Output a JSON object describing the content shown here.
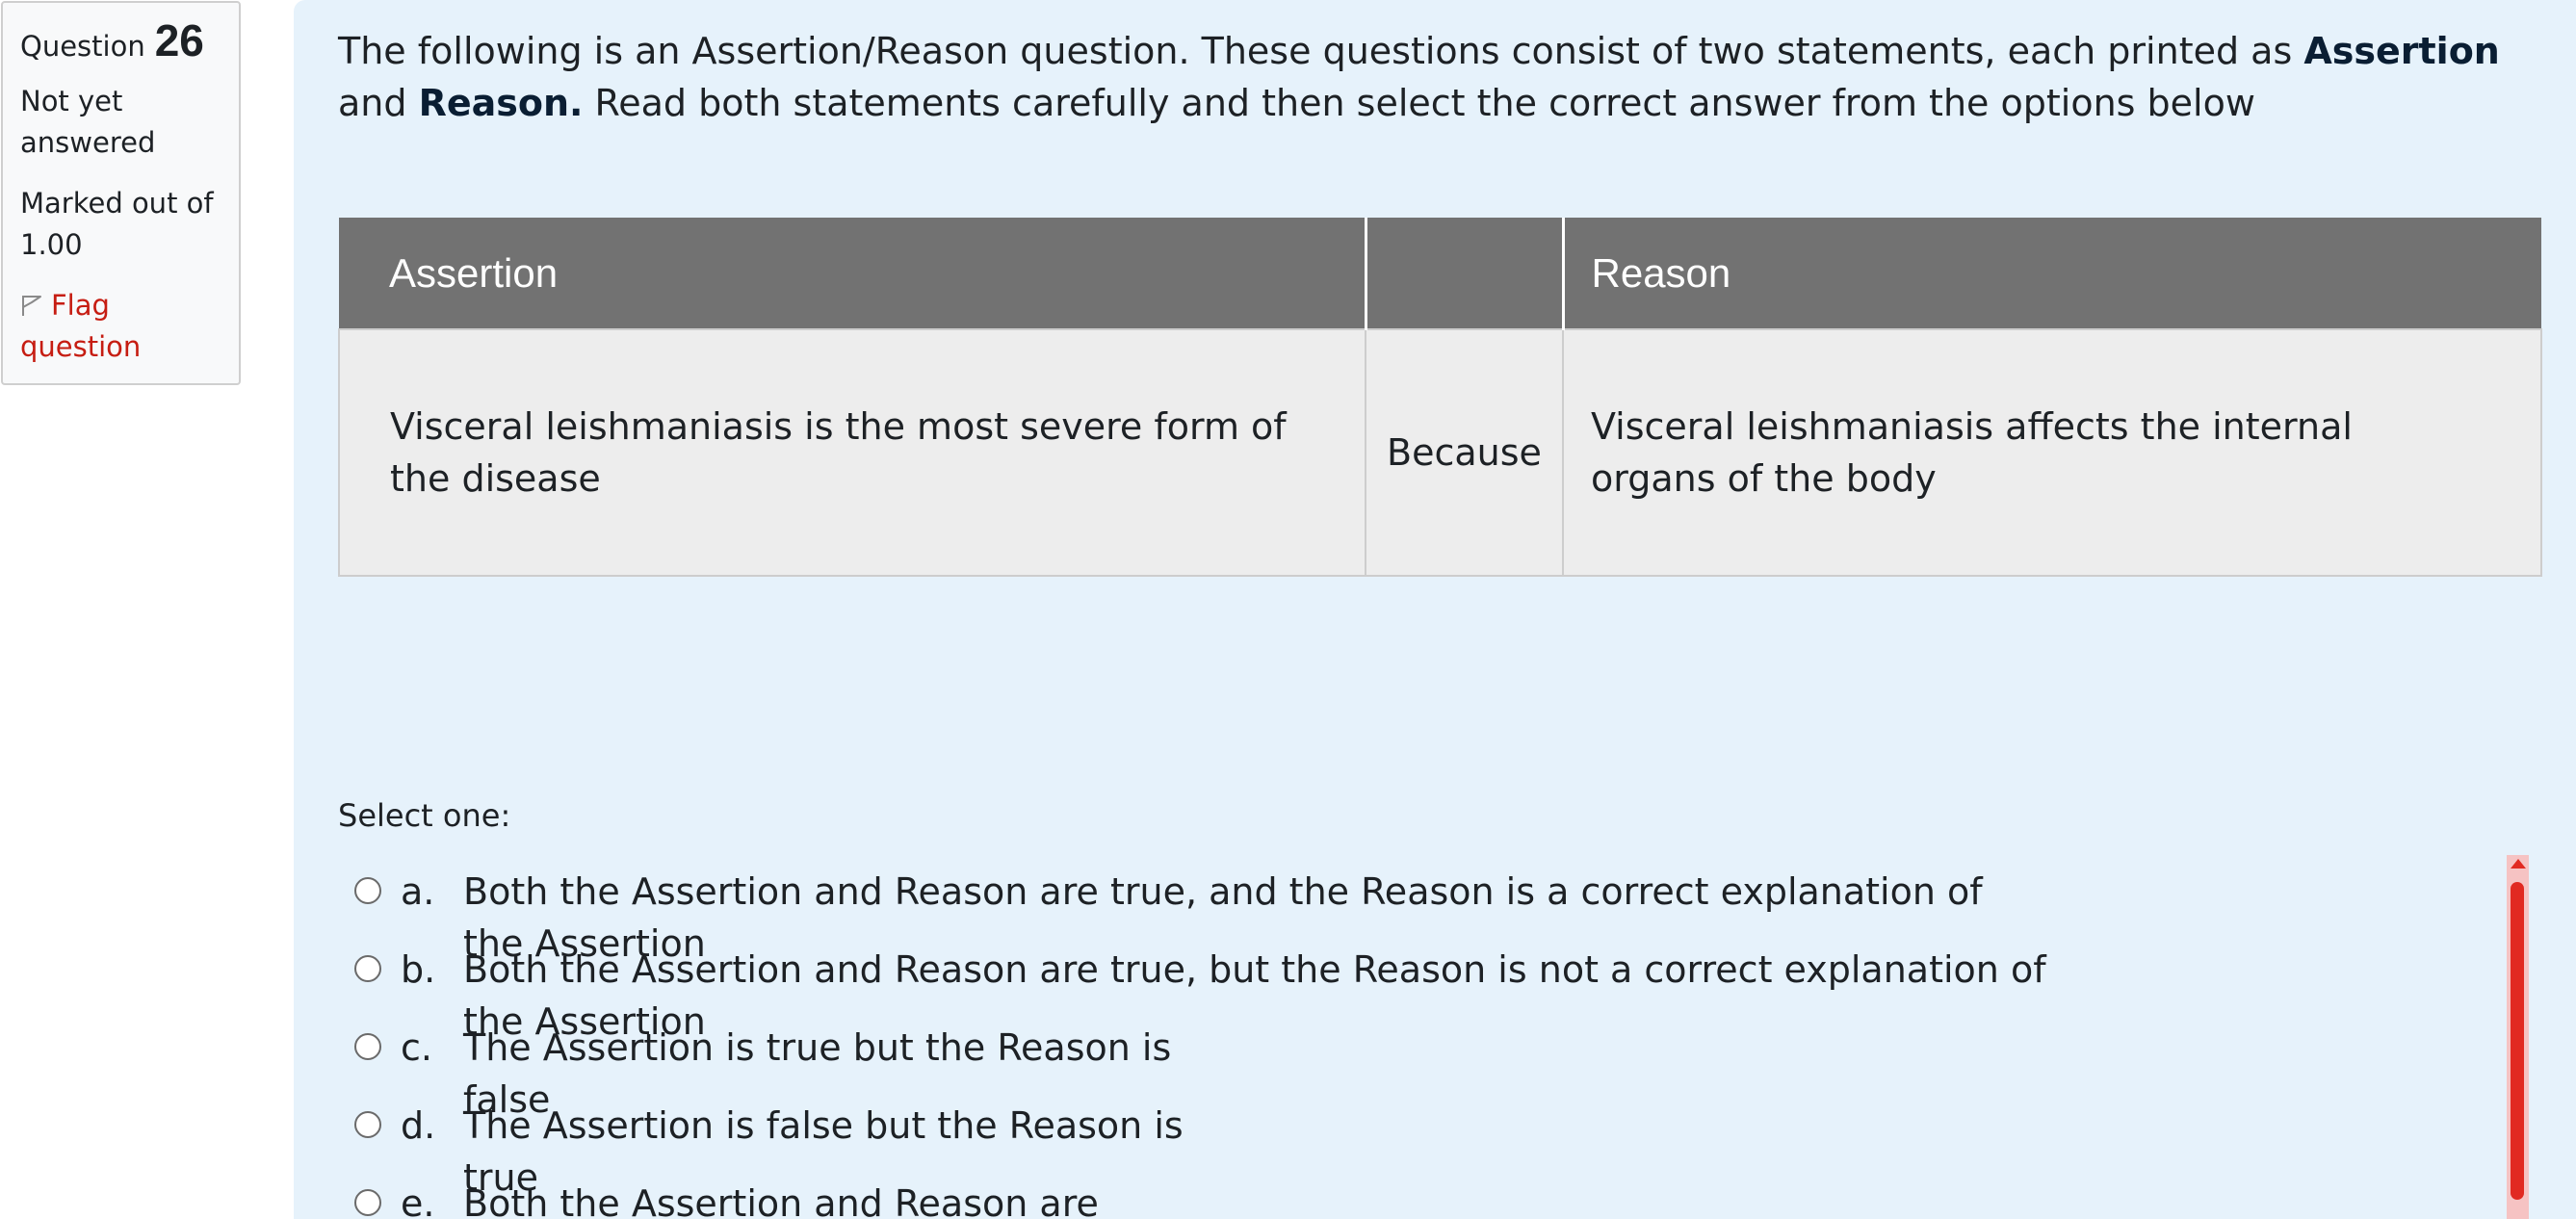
{
  "info": {
    "question_label": "Question",
    "question_number": "26",
    "state": "Not yet answered",
    "grade": "Marked out of 1.00",
    "flag_label": "Flag question"
  },
  "question": {
    "intro_part1": "The following is an Assertion/Reason question.  These questions consist of two statements, each printed as ",
    "intro_bold1": "Assertion",
    "intro_and": " and ",
    "intro_bold2": "Reason.",
    "intro_part2": " Read both statements carefully and then select the correct answer from the options below",
    "table": {
      "header_assertion": "Assertion",
      "header_middle": "",
      "header_reason": "Reason",
      "assertion": "Visceral leishmaniasis is the most severe form of the disease",
      "connector": "Because",
      "reason": "Visceral leishmaniasis affects the internal organs of the body"
    },
    "select_prompt": "Select one:",
    "options": [
      {
        "letter": "a.",
        "text": "Both the Assertion and Reason are true, and the Reason is a correct explanation of the Assertion"
      },
      {
        "letter": "b.",
        "text": "Both the Assertion and Reason are true, but the Reason is not a correct explanation of the Assertion"
      },
      {
        "letter": "c.",
        "text": "The Assertion is true but the Reason is false"
      },
      {
        "letter": "d.",
        "text": "The Assertion is false but the Reason is true"
      },
      {
        "letter": "e.",
        "text": "Both the Assertion and Reason are"
      }
    ]
  },
  "colors": {
    "content_bg": "#e6f2fb",
    "table_header": "#727272",
    "flag": "#c61d12",
    "scrollbar_thumb": "#e12a22"
  },
  "icons": {
    "flag": "flag-icon",
    "radio": "radio-button"
  }
}
